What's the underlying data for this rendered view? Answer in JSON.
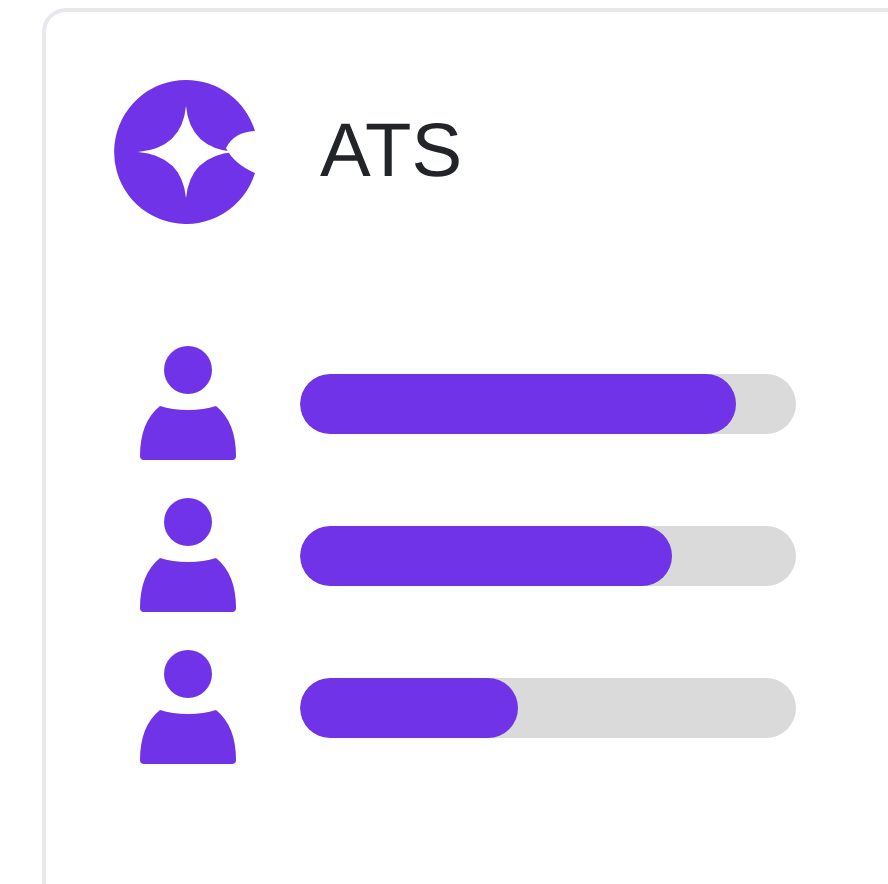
{
  "app": {
    "title": "ATS"
  },
  "candidates": [
    {
      "level": 0.88
    },
    {
      "level": 0.75
    },
    {
      "level": 0.44
    }
  ]
}
